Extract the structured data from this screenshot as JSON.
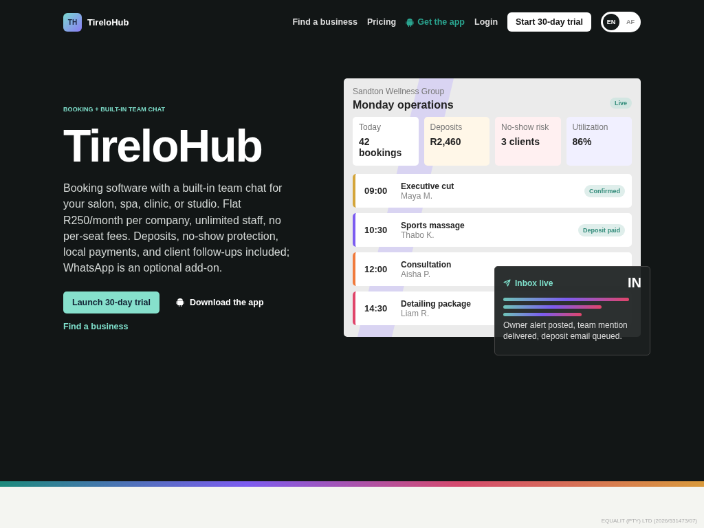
{
  "header": {
    "logo_mark": "TH",
    "brand": "TireloHub",
    "nav": [
      {
        "label": "Find a business",
        "kind": "link"
      },
      {
        "label": "Pricing",
        "kind": "link"
      },
      {
        "label": "Get the app",
        "kind": "app"
      },
      {
        "label": "Login",
        "kind": "link"
      }
    ],
    "cta": "Start 30-day trial",
    "languages": [
      {
        "label": "EN",
        "selected": true
      },
      {
        "label": "AF",
        "selected": false
      }
    ]
  },
  "hero": {
    "eyebrow": "BOOKING + BUILT-IN TEAM CHAT",
    "title": "TireloHub",
    "description": "Booking software with a built-in team chat for your salon, spa, clinic, or studio. Flat R250/month per company, unlimited staff, no per-seat fees. Deposits, no-show protection, local payments, and client follow-ups included; WhatsApp is an optional add-on.",
    "primary_button": "Launch 30-day trial",
    "secondary_button": "Download the app",
    "link": "Find a business"
  },
  "dashboard": {
    "company": "Sandton Wellness Group",
    "title": "Monday operations",
    "badge": "Live",
    "stats": [
      {
        "label": "Today",
        "value": "42 bookings",
        "color": "#ffffff"
      },
      {
        "label": "Deposits",
        "value": "R2,460",
        "color": "#fff7e8"
      },
      {
        "label": "No-show risk",
        "value": "3 clients",
        "color": "#fff0f1"
      },
      {
        "label": "Utilization",
        "value": "86%",
        "color": "#f1f0ff"
      }
    ],
    "appointments": [
      {
        "time": "09:00",
        "service": "Executive cut",
        "client": "Maya M.",
        "status": "Confirmed",
        "color": "#d4a53a"
      },
      {
        "time": "10:30",
        "service": "Sports massage",
        "client": "Thabo K.",
        "status": "Deposit paid",
        "color": "#7c5cf0"
      },
      {
        "time": "12:00",
        "service": "Consultation",
        "client": "Aisha P.",
        "color": "#f07a3c"
      },
      {
        "time": "14:30",
        "service": "Detailing package",
        "client": "Liam R.",
        "color": "#e0456a"
      }
    ]
  },
  "inbox": {
    "title": "Inbox live",
    "initials": "IN",
    "message": "Owner alert posted, team mention delivered, deposit email queued."
  },
  "footer": {
    "company_number": "EQUALIT (PTY) LTD (2026/531473/07)"
  }
}
